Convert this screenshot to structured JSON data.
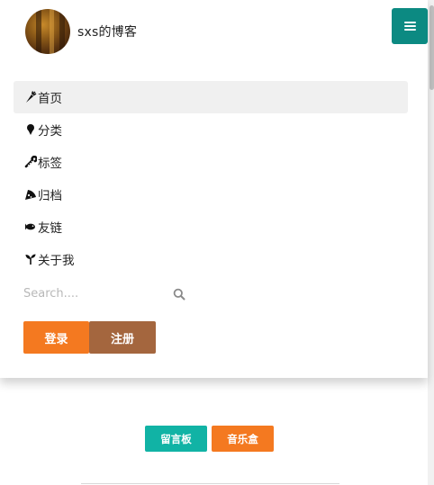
{
  "header": {
    "site_name": "sxs的博客"
  },
  "nav": {
    "items": [
      {
        "label": "首页",
        "icon": "carrot-icon"
      },
      {
        "label": "分类",
        "icon": "ice-cream-icon"
      },
      {
        "label": "标签",
        "icon": "candy-cane-icon"
      },
      {
        "label": "归档",
        "icon": "pizza-slice-icon"
      },
      {
        "label": "友链",
        "icon": "fish-icon"
      },
      {
        "label": "关于我",
        "icon": "seedling-icon"
      }
    ],
    "active_index": 0
  },
  "search": {
    "placeholder": "Search...."
  },
  "auth": {
    "login_label": "登录",
    "register_label": "注册"
  },
  "footer": {
    "guestbook_label": "留言板",
    "music_label": "音乐盒"
  },
  "colors": {
    "toggle": "#0c8a82",
    "login": "#f47920",
    "register": "#a4663e",
    "guestbook": "#11b3a5",
    "music": "#f47920"
  }
}
